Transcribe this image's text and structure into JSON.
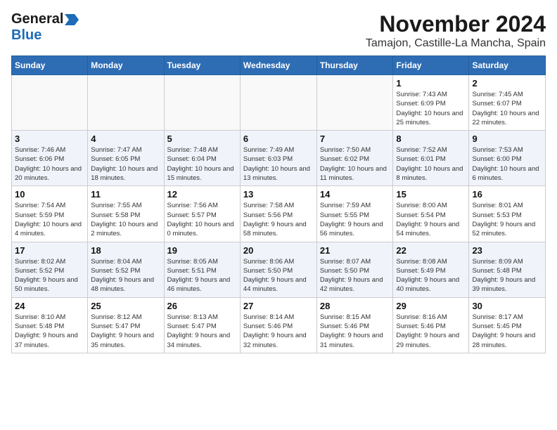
{
  "header": {
    "logo_general": "General",
    "logo_blue": "Blue",
    "month": "November 2024",
    "location": "Tamajon, Castille-La Mancha, Spain"
  },
  "weekdays": [
    "Sunday",
    "Monday",
    "Tuesday",
    "Wednesday",
    "Thursday",
    "Friday",
    "Saturday"
  ],
  "weeks": [
    [
      {
        "day": "",
        "info": ""
      },
      {
        "day": "",
        "info": ""
      },
      {
        "day": "",
        "info": ""
      },
      {
        "day": "",
        "info": ""
      },
      {
        "day": "",
        "info": ""
      },
      {
        "day": "1",
        "info": "Sunrise: 7:43 AM\nSunset: 6:09 PM\nDaylight: 10 hours and 25 minutes."
      },
      {
        "day": "2",
        "info": "Sunrise: 7:45 AM\nSunset: 6:07 PM\nDaylight: 10 hours and 22 minutes."
      }
    ],
    [
      {
        "day": "3",
        "info": "Sunrise: 7:46 AM\nSunset: 6:06 PM\nDaylight: 10 hours and 20 minutes."
      },
      {
        "day": "4",
        "info": "Sunrise: 7:47 AM\nSunset: 6:05 PM\nDaylight: 10 hours and 18 minutes."
      },
      {
        "day": "5",
        "info": "Sunrise: 7:48 AM\nSunset: 6:04 PM\nDaylight: 10 hours and 15 minutes."
      },
      {
        "day": "6",
        "info": "Sunrise: 7:49 AM\nSunset: 6:03 PM\nDaylight: 10 hours and 13 minutes."
      },
      {
        "day": "7",
        "info": "Sunrise: 7:50 AM\nSunset: 6:02 PM\nDaylight: 10 hours and 11 minutes."
      },
      {
        "day": "8",
        "info": "Sunrise: 7:52 AM\nSunset: 6:01 PM\nDaylight: 10 hours and 8 minutes."
      },
      {
        "day": "9",
        "info": "Sunrise: 7:53 AM\nSunset: 6:00 PM\nDaylight: 10 hours and 6 minutes."
      }
    ],
    [
      {
        "day": "10",
        "info": "Sunrise: 7:54 AM\nSunset: 5:59 PM\nDaylight: 10 hours and 4 minutes."
      },
      {
        "day": "11",
        "info": "Sunrise: 7:55 AM\nSunset: 5:58 PM\nDaylight: 10 hours and 2 minutes."
      },
      {
        "day": "12",
        "info": "Sunrise: 7:56 AM\nSunset: 5:57 PM\nDaylight: 10 hours and 0 minutes."
      },
      {
        "day": "13",
        "info": "Sunrise: 7:58 AM\nSunset: 5:56 PM\nDaylight: 9 hours and 58 minutes."
      },
      {
        "day": "14",
        "info": "Sunrise: 7:59 AM\nSunset: 5:55 PM\nDaylight: 9 hours and 56 minutes."
      },
      {
        "day": "15",
        "info": "Sunrise: 8:00 AM\nSunset: 5:54 PM\nDaylight: 9 hours and 54 minutes."
      },
      {
        "day": "16",
        "info": "Sunrise: 8:01 AM\nSunset: 5:53 PM\nDaylight: 9 hours and 52 minutes."
      }
    ],
    [
      {
        "day": "17",
        "info": "Sunrise: 8:02 AM\nSunset: 5:52 PM\nDaylight: 9 hours and 50 minutes."
      },
      {
        "day": "18",
        "info": "Sunrise: 8:04 AM\nSunset: 5:52 PM\nDaylight: 9 hours and 48 minutes."
      },
      {
        "day": "19",
        "info": "Sunrise: 8:05 AM\nSunset: 5:51 PM\nDaylight: 9 hours and 46 minutes."
      },
      {
        "day": "20",
        "info": "Sunrise: 8:06 AM\nSunset: 5:50 PM\nDaylight: 9 hours and 44 minutes."
      },
      {
        "day": "21",
        "info": "Sunrise: 8:07 AM\nSunset: 5:50 PM\nDaylight: 9 hours and 42 minutes."
      },
      {
        "day": "22",
        "info": "Sunrise: 8:08 AM\nSunset: 5:49 PM\nDaylight: 9 hours and 40 minutes."
      },
      {
        "day": "23",
        "info": "Sunrise: 8:09 AM\nSunset: 5:48 PM\nDaylight: 9 hours and 39 minutes."
      }
    ],
    [
      {
        "day": "24",
        "info": "Sunrise: 8:10 AM\nSunset: 5:48 PM\nDaylight: 9 hours and 37 minutes."
      },
      {
        "day": "25",
        "info": "Sunrise: 8:12 AM\nSunset: 5:47 PM\nDaylight: 9 hours and 35 minutes."
      },
      {
        "day": "26",
        "info": "Sunrise: 8:13 AM\nSunset: 5:47 PM\nDaylight: 9 hours and 34 minutes."
      },
      {
        "day": "27",
        "info": "Sunrise: 8:14 AM\nSunset: 5:46 PM\nDaylight: 9 hours and 32 minutes."
      },
      {
        "day": "28",
        "info": "Sunrise: 8:15 AM\nSunset: 5:46 PM\nDaylight: 9 hours and 31 minutes."
      },
      {
        "day": "29",
        "info": "Sunrise: 8:16 AM\nSunset: 5:46 PM\nDaylight: 9 hours and 29 minutes."
      },
      {
        "day": "30",
        "info": "Sunrise: 8:17 AM\nSunset: 5:45 PM\nDaylight: 9 hours and 28 minutes."
      }
    ]
  ]
}
